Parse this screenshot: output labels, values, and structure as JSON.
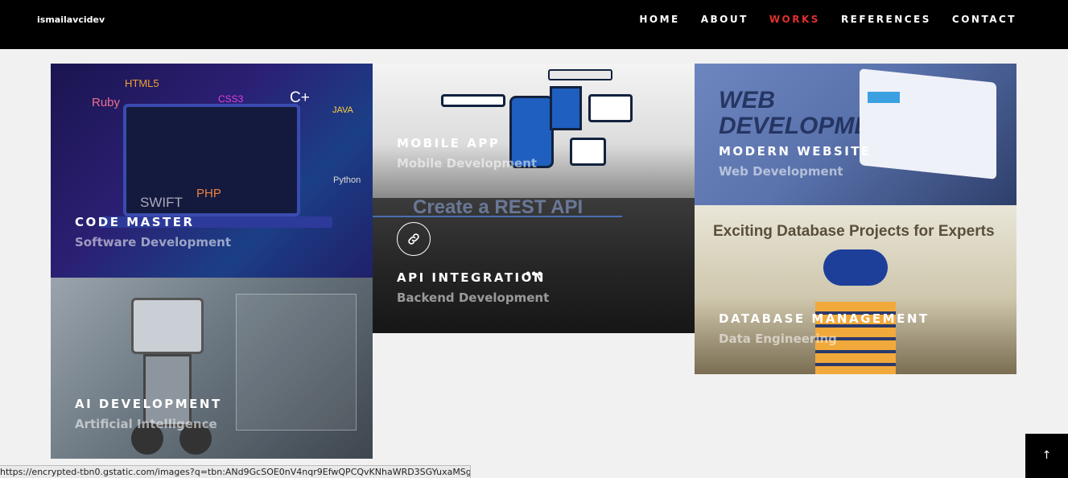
{
  "nav": {
    "brand": "ismailavcidev",
    "items": [
      {
        "label": "HOME"
      },
      {
        "label": "ABOUT"
      },
      {
        "label": "WORKS",
        "active": true
      },
      {
        "label": "REFERENCES"
      },
      {
        "label": "CONTACT"
      }
    ]
  },
  "works": [
    {
      "title": "CODE MASTER",
      "subtitle": "Software Development",
      "image_words": [
        "HTML5",
        "Ruby",
        "CSS3",
        "C+",
        "JAVA",
        "SWIFT",
        "PHP",
        "Python"
      ]
    },
    {
      "title": "MOBILE APP",
      "subtitle": "Mobile Development"
    },
    {
      "title": "API INTEGRATION",
      "subtitle": "Backend Development",
      "image_text": "Create a REST API",
      "dots": "•••"
    },
    {
      "title": "MODERN WEBSITE",
      "subtitle": "Web Development",
      "image_text": "WEB DEVELOPMENT"
    },
    {
      "title": "DATABASE MANAGEMENT",
      "subtitle": "Data Engineering",
      "image_text": "Exciting Database Projects for Experts"
    },
    {
      "title": "AI DEVELOPMENT",
      "subtitle": "Artificial Intelligence"
    }
  ],
  "back_to_top": "↑",
  "status_url": "https://encrypted-tbn0.gstatic.com/images?q=tbn:ANd9GcSOE0nV4nqr9EfwQPCQvKNhaWRD3SGYuxaMSg&s",
  "colors": {
    "accent": "#e0302f",
    "nav_bg": "#000000"
  }
}
